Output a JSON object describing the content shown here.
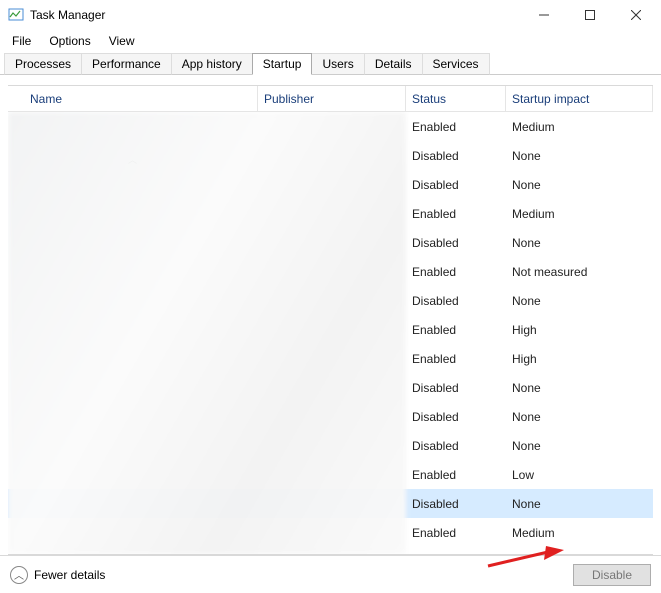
{
  "window": {
    "title": "Task Manager"
  },
  "menu": {
    "file": "File",
    "options": "Options",
    "view": "View"
  },
  "tabs": {
    "processes": "Processes",
    "performance": "Performance",
    "app_history": "App history",
    "startup": "Startup",
    "users": "Users",
    "details": "Details",
    "services": "Services"
  },
  "columns": {
    "name": "Name",
    "publisher": "Publisher",
    "status": "Status",
    "impact": "Startup impact"
  },
  "rows": [
    {
      "name": "",
      "publisher": "",
      "status": "Enabled",
      "impact": "Medium",
      "selected": false
    },
    {
      "name": "",
      "publisher": "",
      "status": "Disabled",
      "impact": "None",
      "selected": false
    },
    {
      "name": "",
      "publisher": "",
      "status": "Disabled",
      "impact": "None",
      "selected": false
    },
    {
      "name": "",
      "publisher": "",
      "status": "Enabled",
      "impact": "Medium",
      "selected": false
    },
    {
      "name": "",
      "publisher": "",
      "status": "Disabled",
      "impact": "None",
      "selected": false
    },
    {
      "name": "",
      "publisher": "",
      "status": "Enabled",
      "impact": "Not measured",
      "selected": false
    },
    {
      "name": "",
      "publisher": "",
      "status": "Disabled",
      "impact": "None",
      "selected": false
    },
    {
      "name": "",
      "publisher": "",
      "status": "Enabled",
      "impact": "High",
      "selected": false
    },
    {
      "name": "",
      "publisher": "",
      "status": "Enabled",
      "impact": "High",
      "selected": false
    },
    {
      "name": "",
      "publisher": "",
      "status": "Disabled",
      "impact": "None",
      "selected": false
    },
    {
      "name": "",
      "publisher": "",
      "status": "Disabled",
      "impact": "None",
      "selected": false
    },
    {
      "name": "",
      "publisher": "",
      "status": "Disabled",
      "impact": "None",
      "selected": false
    },
    {
      "name": "",
      "publisher": "",
      "status": "Enabled",
      "impact": "Low",
      "selected": false
    },
    {
      "name": "",
      "publisher": "",
      "status": "Disabled",
      "impact": "None",
      "selected": true
    },
    {
      "name": "",
      "publisher": "",
      "status": "Enabled",
      "impact": "Medium",
      "selected": false
    }
  ],
  "footer": {
    "fewer_details": "Fewer details",
    "disable": "Disable"
  },
  "colors": {
    "header_text": "#1a3e7a",
    "selected_row": "#d6ebff",
    "arrow": "#e02020"
  }
}
